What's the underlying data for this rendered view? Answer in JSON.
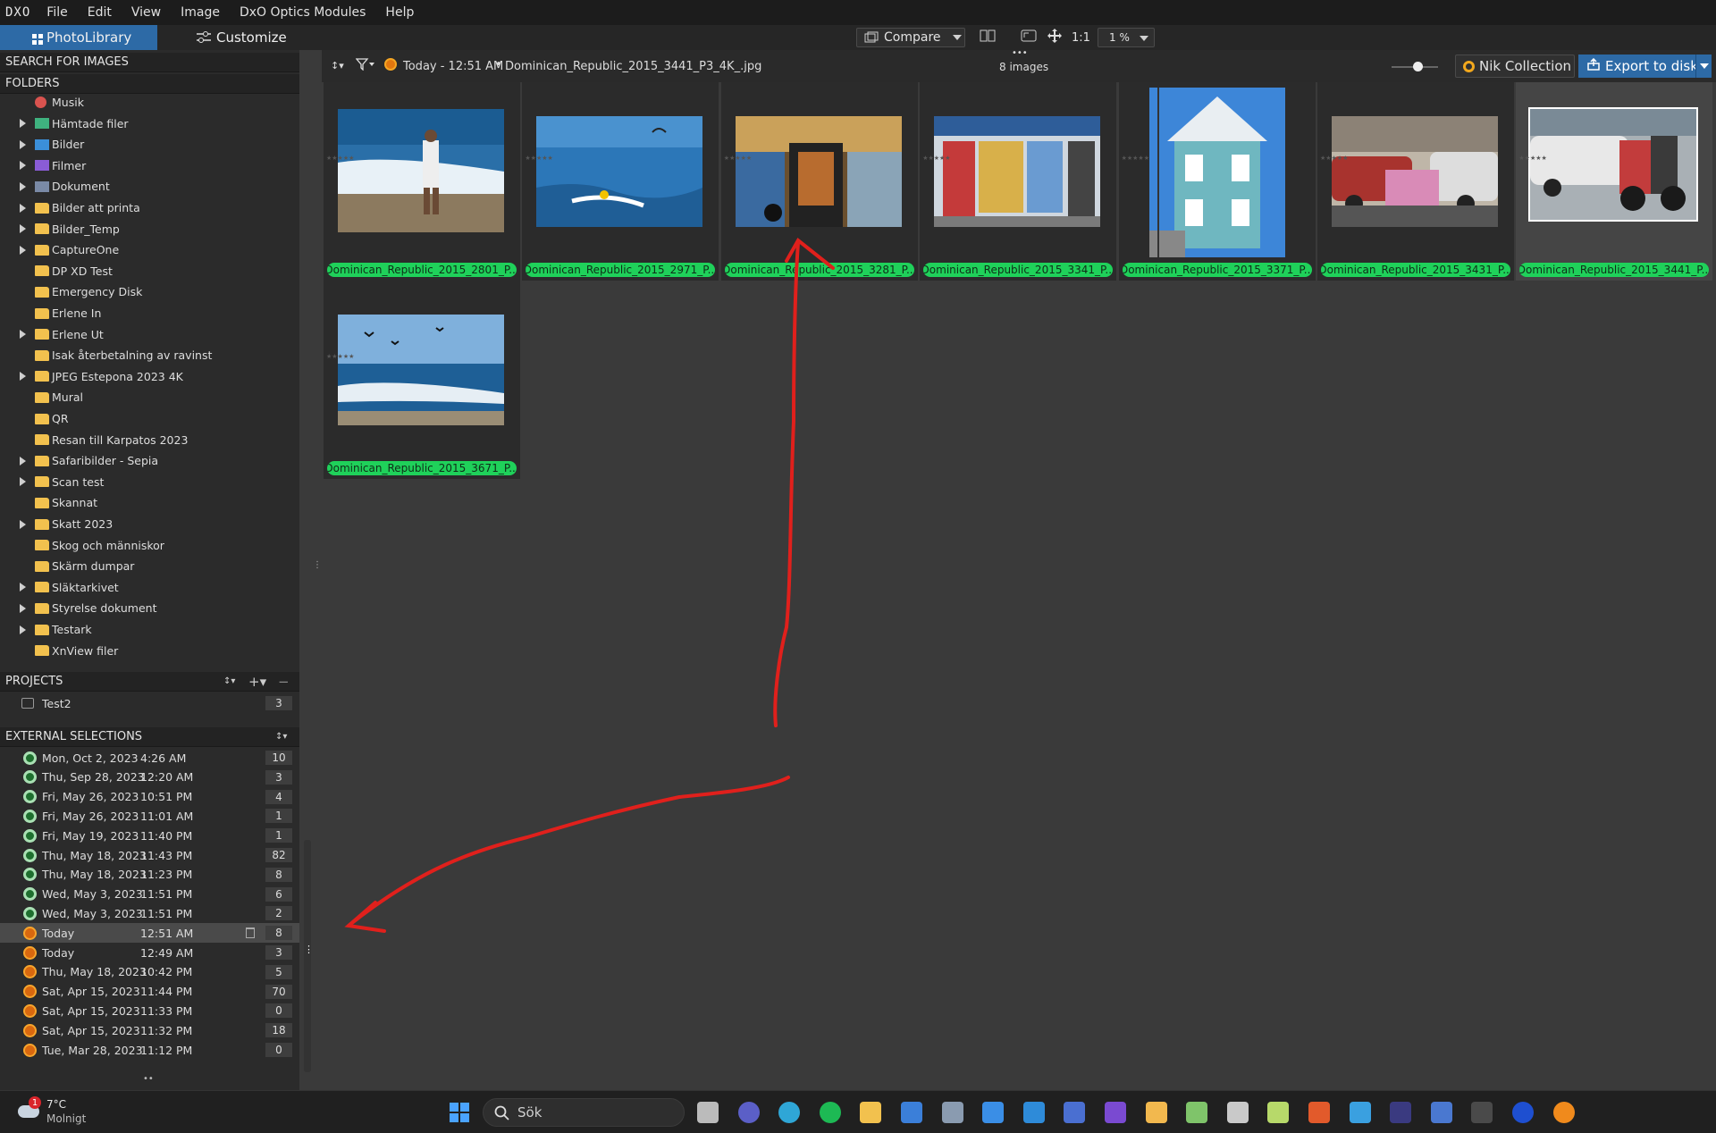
{
  "app": {
    "logo_text": "DXO"
  },
  "menu": {
    "items": [
      "File",
      "Edit",
      "View",
      "Image",
      "DxO Optics Modules",
      "Help"
    ]
  },
  "toolbar": {
    "tab_photolibrary": "PhotoLibrary",
    "tab_customize": "Customize",
    "compare_label": "Compare",
    "one_to_one": "1:1",
    "zoom_value": "1 %",
    "nik_label": "Nik Collection",
    "export_label": "Export to disk"
  },
  "browser_header": {
    "source_label": "Today - 12:51 AM",
    "filename": "Dominican_Republic_2015_3441_P3_4K_.jpg",
    "count_label": "8 images"
  },
  "panels": {
    "search_header": "SEARCH FOR IMAGES",
    "folders_header": "FOLDERS",
    "projects_header": "PROJECTS",
    "external_header": "EXTERNAL SELECTIONS"
  },
  "folders": [
    {
      "name": "Musik",
      "expandable": false,
      "icon": "music-icon"
    },
    {
      "name": "Hämtade filer",
      "expandable": true,
      "icon": "download-icon"
    },
    {
      "name": "Bilder",
      "expandable": true,
      "icon": "pictures-icon"
    },
    {
      "name": "Filmer",
      "expandable": true,
      "icon": "videos-icon"
    },
    {
      "name": "Dokument",
      "expandable": true,
      "icon": "documents-icon"
    },
    {
      "name": "Bilder att printa",
      "expandable": true,
      "icon": "folder-icon"
    },
    {
      "name": "Bilder_Temp",
      "expandable": true,
      "icon": "folder-icon"
    },
    {
      "name": "CaptureOne",
      "expandable": true,
      "icon": "folder-icon"
    },
    {
      "name": "DP XD Test",
      "expandable": false,
      "icon": "folder-icon"
    },
    {
      "name": "Emergency Disk",
      "expandable": false,
      "icon": "folder-icon"
    },
    {
      "name": "Erlene In",
      "expandable": false,
      "icon": "folder-icon"
    },
    {
      "name": "Erlene Ut",
      "expandable": true,
      "icon": "folder-icon"
    },
    {
      "name": "Isak återbetalning av ravinst",
      "expandable": false,
      "icon": "folder-icon"
    },
    {
      "name": "JPEG Estepona 2023 4K",
      "expandable": true,
      "icon": "folder-icon"
    },
    {
      "name": "Mural",
      "expandable": false,
      "icon": "folder-icon"
    },
    {
      "name": "QR",
      "expandable": false,
      "icon": "folder-icon"
    },
    {
      "name": "Resan till Karpatos 2023",
      "expandable": false,
      "icon": "folder-icon"
    },
    {
      "name": "Safaribilder - Sepia",
      "expandable": true,
      "icon": "folder-icon"
    },
    {
      "name": "Scan test",
      "expandable": true,
      "icon": "folder-icon"
    },
    {
      "name": "Skannat",
      "expandable": false,
      "icon": "folder-icon"
    },
    {
      "name": "Skatt 2023",
      "expandable": true,
      "icon": "folder-icon"
    },
    {
      "name": "Skog och människor",
      "expandable": false,
      "icon": "folder-icon"
    },
    {
      "name": "Skärm dumpar",
      "expandable": false,
      "icon": "folder-icon"
    },
    {
      "name": "Släktarkivet",
      "expandable": true,
      "icon": "folder-icon"
    },
    {
      "name": "Styrelse dokument",
      "expandable": true,
      "icon": "folder-icon"
    },
    {
      "name": "Testark",
      "expandable": true,
      "icon": "folder-icon"
    },
    {
      "name": "XnView filer",
      "expandable": false,
      "icon": "folder-icon"
    }
  ],
  "projects": [
    {
      "name": "Test2",
      "count": "3"
    }
  ],
  "external_selections": [
    {
      "date": "Mon, Oct 2, 2023",
      "time": "4:26 AM",
      "count": "10",
      "icon": "nik-icon"
    },
    {
      "date": "Thu, Sep 28, 2023",
      "time": "12:20 AM",
      "count": "3",
      "icon": "nik-icon"
    },
    {
      "date": "Fri, May 26, 2023",
      "time": "10:51 PM",
      "count": "4",
      "icon": "nik-icon"
    },
    {
      "date": "Fri, May 26, 2023",
      "time": "11:01 AM",
      "count": "1",
      "icon": "nik-icon"
    },
    {
      "date": "Fri, May 19, 2023",
      "time": "11:40 PM",
      "count": "1",
      "icon": "nik-icon"
    },
    {
      "date": "Thu, May 18, 2023",
      "time": "11:43 PM",
      "count": "82",
      "icon": "nik-icon"
    },
    {
      "date": "Thu, May 18, 2023",
      "time": "11:23 PM",
      "count": "8",
      "icon": "nik-icon"
    },
    {
      "date": "Wed, May 3, 2023",
      "time": "11:51 PM",
      "count": "6",
      "icon": "nik-icon"
    },
    {
      "date": "Wed, May 3, 2023",
      "time": "11:51 PM",
      "count": "2",
      "icon": "nik-icon"
    },
    {
      "date": "Today",
      "time": "12:51 AM",
      "count": "8",
      "icon": "sun-icon",
      "active": true
    },
    {
      "date": "Today",
      "time": "12:49 AM",
      "count": "3",
      "icon": "sun-icon"
    },
    {
      "date": "Thu, May 18, 2023",
      "time": "10:42 PM",
      "count": "5",
      "icon": "sun-icon"
    },
    {
      "date": "Sat, Apr 15, 2023",
      "time": "11:44 PM",
      "count": "70",
      "icon": "sun-icon"
    },
    {
      "date": "Sat, Apr 15, 2023",
      "time": "11:33 PM",
      "count": "0",
      "icon": "sun-icon"
    },
    {
      "date": "Sat, Apr 15, 2023",
      "time": "11:32 PM",
      "count": "18",
      "icon": "sun-icon"
    },
    {
      "date": "Tue, Mar 28, 2023",
      "time": "11:12 PM",
      "count": "0",
      "icon": "sun-icon"
    }
  ],
  "thumbnails": [
    {
      "label": "Dominican_Republic_2015_2801_P...",
      "scene": "beach-kite"
    },
    {
      "label": "Dominican_Republic_2015_2971_P...",
      "scene": "sea-kite"
    },
    {
      "label": "Dominican_Republic_2015_3281_P...",
      "scene": "shop-front"
    },
    {
      "label": "Dominican_Republic_2015_3341_P...",
      "scene": "kiosk"
    },
    {
      "label": "Dominican_Republic_2015_3371_P...",
      "scene": "blue-house"
    },
    {
      "label": "Dominican_Republic_2015_3431_P...",
      "scene": "street-cars"
    },
    {
      "label": "Dominican_Republic_2015_3441_P...",
      "scene": "motorbike",
      "selected": true
    },
    {
      "label": "Dominican_Republic_2015_3671_P...",
      "scene": "sea-birds"
    }
  ],
  "taskbar": {
    "weather_temp": "7°C",
    "weather_desc": "Molnigt",
    "weather_badge": "1",
    "search_placeholder": "Sök"
  },
  "colors": {
    "accent_blue": "#2d6aa6",
    "label_green": "#1fd15a",
    "annotation_red": "#e0201c"
  }
}
